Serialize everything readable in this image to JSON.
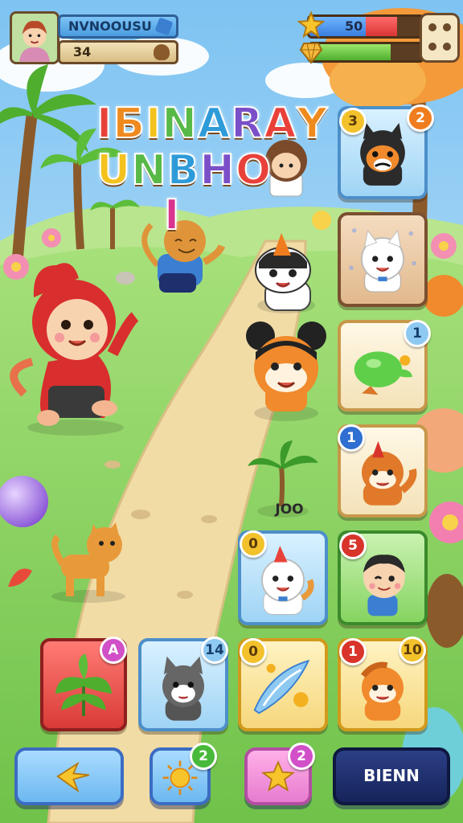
{
  "hud": {
    "player_name": "NVNOOUSU",
    "player_level": "34",
    "hp_value": "50",
    "hp_fraction": 0.78,
    "energy_fraction": 0.72
  },
  "title": {
    "line1": "IБINARAY",
    "line2": "UNBHO",
    "line2_end": "I",
    "line1_colors": [
      "#e8413a",
      "#ef8a1e",
      "#f3c21f",
      "#58b947",
      "#2e9bd8",
      "#7a4fc7",
      "#e8413a",
      "#ef8a1e"
    ],
    "line2_colors": [
      "#f3c21f",
      "#58b947",
      "#2e9bd8",
      "#7a4fc7",
      "#e8413a"
    ],
    "line2_end_color": "#d9348f"
  },
  "path_sign": "JOO",
  "cards": [
    {
      "id": "husky-dog",
      "badge_left": "3",
      "badge_right": "2",
      "icon": "husky-icon"
    },
    {
      "id": "white-cat",
      "icon": "white-cat-icon"
    },
    {
      "id": "green-seed",
      "badge_right": "1",
      "icon": "green-seed-icon"
    },
    {
      "id": "fox",
      "badge_left": "1",
      "icon": "fox-icon"
    },
    {
      "id": "kitten",
      "badge_left": "0",
      "icon": "kitten-icon"
    },
    {
      "id": "boy",
      "badge_left": "5",
      "icon": "boy-icon"
    },
    {
      "id": "leaf",
      "badge_right": "A",
      "icon": "leaf-icon"
    },
    {
      "id": "gray-cat",
      "badge_right": "14",
      "icon": "gray-cat-icon"
    },
    {
      "id": "wand",
      "badge_left": "0",
      "icon": "wand-icon"
    },
    {
      "id": "ginger-cat",
      "badge_left": "1",
      "badge_right": "10",
      "icon": "ginger-cat-icon"
    }
  ],
  "bottom_bar": {
    "back_icon": "arrow-star-icon",
    "sun_badge": "2",
    "star_badge": "2",
    "main_button": "BIENN"
  },
  "colors": {
    "sky": "#9fd3f5",
    "grass": "#8fd46a",
    "path": "#f1dca6",
    "button_blue": "#7cc7f7",
    "button_navy": "#1e2f6e"
  }
}
